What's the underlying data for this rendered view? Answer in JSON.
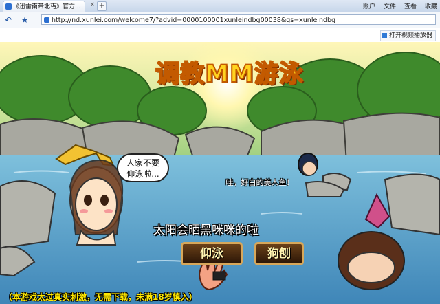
{
  "browser": {
    "tab_title": "《迅雷南帝北丐》官方...",
    "tab_close": "×",
    "tab_new": "+",
    "menu": [
      "账户",
      "文件",
      "查看",
      "收藏"
    ],
    "url": "http://nd.xunlei.com/welcome7/?advid=0000100001xunleindbg00038&gs=xunleindbg",
    "video_player_button": "打开视频播放器",
    "nav": {
      "back": "↶",
      "star": "★"
    }
  },
  "game": {
    "title": "调教MM游泳",
    "speech_left": [
      "人家不要",
      "仰泳啦..."
    ],
    "speech_right": "哇，好白的美人鱼！",
    "hint": "太阳会晒黑咪咪的啦",
    "button_backstroke": "仰泳",
    "button_dogpaddle": "狗刨",
    "footer_notice": "（本游戏太过真实刺激，无需下载，未满18岁慎入）"
  },
  "colors": {
    "title_fill": "#ffd320",
    "title_outline": "#c35a00",
    "water": "#5a9ec8",
    "footer_text": "#ffe800",
    "button_border": "#d7a75a"
  }
}
